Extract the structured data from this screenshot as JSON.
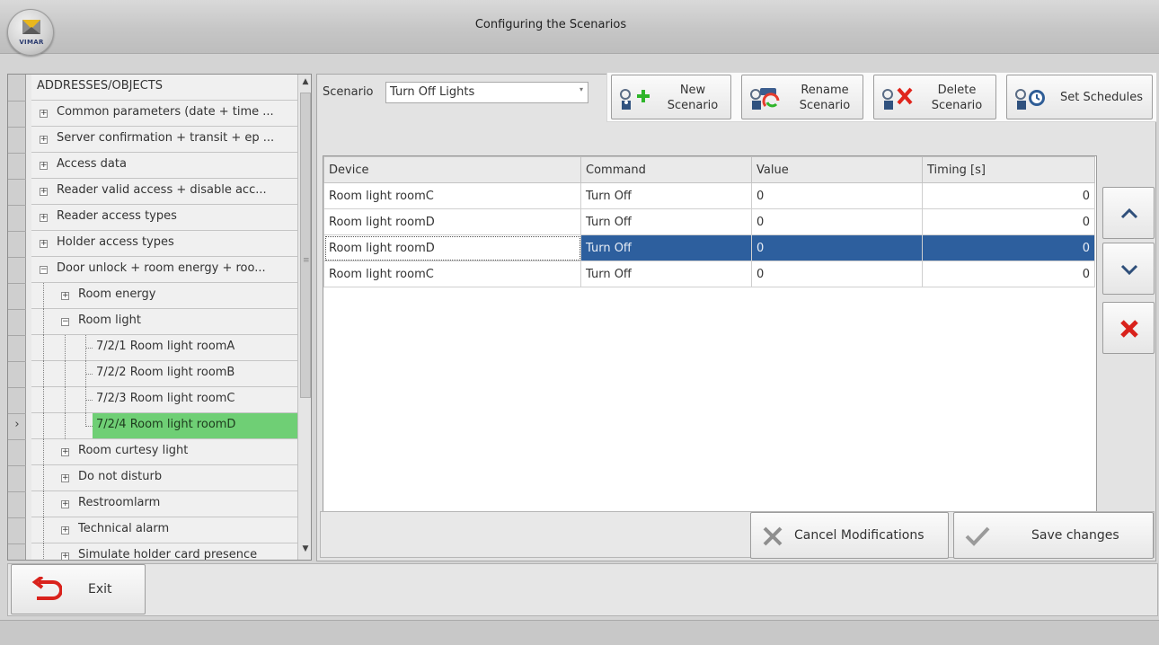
{
  "window": {
    "title": "Configuring the Scenarios",
    "logo_text": "VIMAR"
  },
  "tree": {
    "header": "ADDRESSES/OBJECTS",
    "items": [
      {
        "label": "Common parameters (date + time ...",
        "expander": "+"
      },
      {
        "label": "Server confirmation + transit + ep ...",
        "expander": "+"
      },
      {
        "label": "Access data",
        "expander": "+"
      },
      {
        "label": "Reader valid access + disable acc...",
        "expander": "+"
      },
      {
        "label": "Reader access types",
        "expander": "+"
      },
      {
        "label": "Holder access types",
        "expander": "+"
      },
      {
        "label": "Door unlock + room energy + roo...",
        "expander": "−"
      },
      {
        "label": "Room energy",
        "expander": "+"
      },
      {
        "label": "Room light",
        "expander": "−"
      },
      {
        "label": "7/2/1 Room light roomA"
      },
      {
        "label": "7/2/2 Room light roomB"
      },
      {
        "label": "7/2/3 Room light roomC"
      },
      {
        "label": "7/2/4 Room light roomD",
        "selected": true
      },
      {
        "label": "Room curtesy light",
        "expander": "+"
      },
      {
        "label": "Do not disturb",
        "expander": "+"
      },
      {
        "label": "Restroomlarm",
        "expander": "+"
      },
      {
        "label": "Technical alarm",
        "expander": "+"
      },
      {
        "label": "Simulate holder card presence",
        "expander": "+"
      }
    ],
    "side_arrow": "›",
    "scroll_up": "▲",
    "scroll_down": "▼"
  },
  "scenario": {
    "label": "Scenario",
    "value": "Turn Off Lights",
    "arrow": "▾"
  },
  "toolbar": {
    "new_line1": "New",
    "new_line2": "Scenario",
    "rename_line1": "Rename",
    "rename_line2": "Scenario",
    "delete_line1": "Delete",
    "delete_line2": "Scenario",
    "schedules": "Set Schedules"
  },
  "table": {
    "headers": {
      "device": "Device",
      "command": "Command",
      "value": "Value",
      "timing": "Timing [s]"
    },
    "rows": [
      {
        "device": "Room light roomC",
        "command": "Turn Off",
        "value": "0",
        "timing": "0"
      },
      {
        "device": "Room light roomD",
        "command": "Turn Off",
        "value": "0",
        "timing": "0"
      },
      {
        "device": "Room light roomD",
        "command": "Turn Off",
        "value": "0",
        "timing": "0"
      },
      {
        "device": "Room light roomC",
        "command": "Turn Off",
        "value": "0",
        "timing": "0"
      }
    ]
  },
  "actions": {
    "cancel": "Cancel Modifications",
    "save": "Save changes",
    "exit": "Exit"
  },
  "colors": {
    "selection_green": "#6fcf75",
    "selection_blue": "#2d5f9e",
    "delete_red": "#d9221c",
    "add_green": "#2fb52a"
  }
}
